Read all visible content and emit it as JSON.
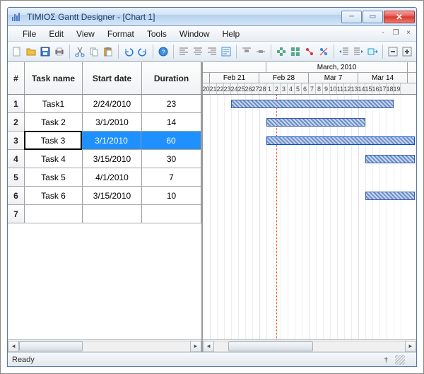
{
  "window": {
    "title": "ΤΙΜΙΟΣ Gantt Designer - [Chart 1]"
  },
  "menu": {
    "file": "File",
    "edit": "Edit",
    "view": "View",
    "format": "Format",
    "tools": "Tools",
    "window": "Window",
    "help": "Help"
  },
  "grid": {
    "headers": {
      "num": "#",
      "task": "Task name",
      "start": "Start date",
      "duration": "Duration"
    },
    "rows": [
      {
        "num": "1",
        "task": "Task1",
        "start": "2/24/2010",
        "duration": "23"
      },
      {
        "num": "2",
        "task": "Task 2",
        "start": "3/1/2010",
        "duration": "14"
      },
      {
        "num": "3",
        "task": "Task 3",
        "start": "3/1/2010",
        "duration": "60"
      },
      {
        "num": "4",
        "task": "Task 4",
        "start": "3/15/2010",
        "duration": "30"
      },
      {
        "num": "5",
        "task": "Task 5",
        "start": "4/1/2010",
        "duration": "7"
      },
      {
        "num": "6",
        "task": "Task 6",
        "start": "3/15/2010",
        "duration": "10"
      },
      {
        "num": "7",
        "task": "",
        "start": "",
        "duration": ""
      }
    ],
    "selected_index": 2,
    "focus_col": "task"
  },
  "timeline": {
    "months": [
      {
        "label": "",
        "days": 9
      },
      {
        "label": "March, 2010",
        "days": 20
      }
    ],
    "weeks": [
      {
        "label": "",
        "days": 1
      },
      {
        "label": "Feb 21",
        "days": 7
      },
      {
        "label": "Feb 28",
        "days": 7
      },
      {
        "label": "Mar 7",
        "days": 7
      },
      {
        "label": "Mar 14",
        "days": 7
      }
    ],
    "days": [
      "20",
      "21",
      "22",
      "23",
      "24",
      "25",
      "26",
      "27",
      "28",
      "1",
      "2",
      "3",
      "4",
      "5",
      "6",
      "7",
      "8",
      "9",
      "10",
      "11",
      "12",
      "13",
      "14",
      "15",
      "16",
      "17",
      "18",
      "19"
    ],
    "today_index": 10
  },
  "status": {
    "text": "Ready"
  },
  "chart_data": {
    "type": "gantt",
    "title": "Chart 1",
    "date_range_visible": [
      "2010-02-20",
      "2010-03-19"
    ],
    "tasks": [
      {
        "name": "Task1",
        "start": "2010-02-24",
        "duration_days": 23
      },
      {
        "name": "Task 2",
        "start": "2010-03-01",
        "duration_days": 14
      },
      {
        "name": "Task 3",
        "start": "2010-03-01",
        "duration_days": 60
      },
      {
        "name": "Task 4",
        "start": "2010-03-15",
        "duration_days": 30
      },
      {
        "name": "Task 5",
        "start": "2010-04-01",
        "duration_days": 7
      },
      {
        "name": "Task 6",
        "start": "2010-03-15",
        "duration_days": 10
      }
    ]
  }
}
